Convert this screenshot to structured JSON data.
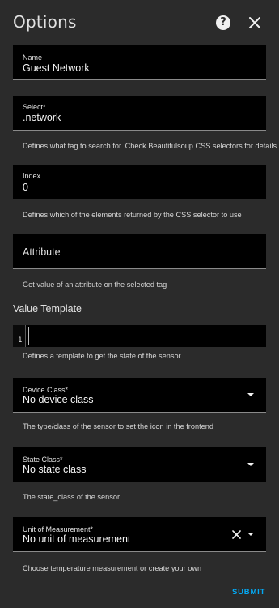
{
  "dialog": {
    "title": "Options",
    "help_icon_glyph": "?",
    "submit_label": "SUBMIT"
  },
  "fields": {
    "name": {
      "label": "Name",
      "value": "Guest Network"
    },
    "select": {
      "label": "Select*",
      "value": ".network",
      "helper": "Defines what tag to search for. Check Beautifulsoup CSS selectors for details"
    },
    "index": {
      "label": "Index",
      "value": "0",
      "helper": "Defines which of the elements returned by the CSS selector to use"
    },
    "attribute": {
      "placeholder": "Attribute",
      "helper": "Get value of an attribute on the selected tag"
    },
    "value_template": {
      "title": "Value Template",
      "line_number": "1",
      "helper": "Defines a template to get the state of the sensor"
    },
    "device_class": {
      "label": "Device Class*",
      "value": "No device class",
      "helper": "The type/class of the sensor to set the icon in the frontend"
    },
    "state_class": {
      "label": "State Class*",
      "value": "No state class",
      "helper": "The state_class of the sensor"
    },
    "unit_of_measurement": {
      "label": "Unit of Measurement*",
      "value": "No unit of measurement",
      "helper": "Choose temperature measurement or create your own"
    }
  },
  "colors": {
    "background": "#2b2b2b",
    "field_background": "#000000",
    "accent": "#03a9f4",
    "text": "#e1e1e1"
  }
}
